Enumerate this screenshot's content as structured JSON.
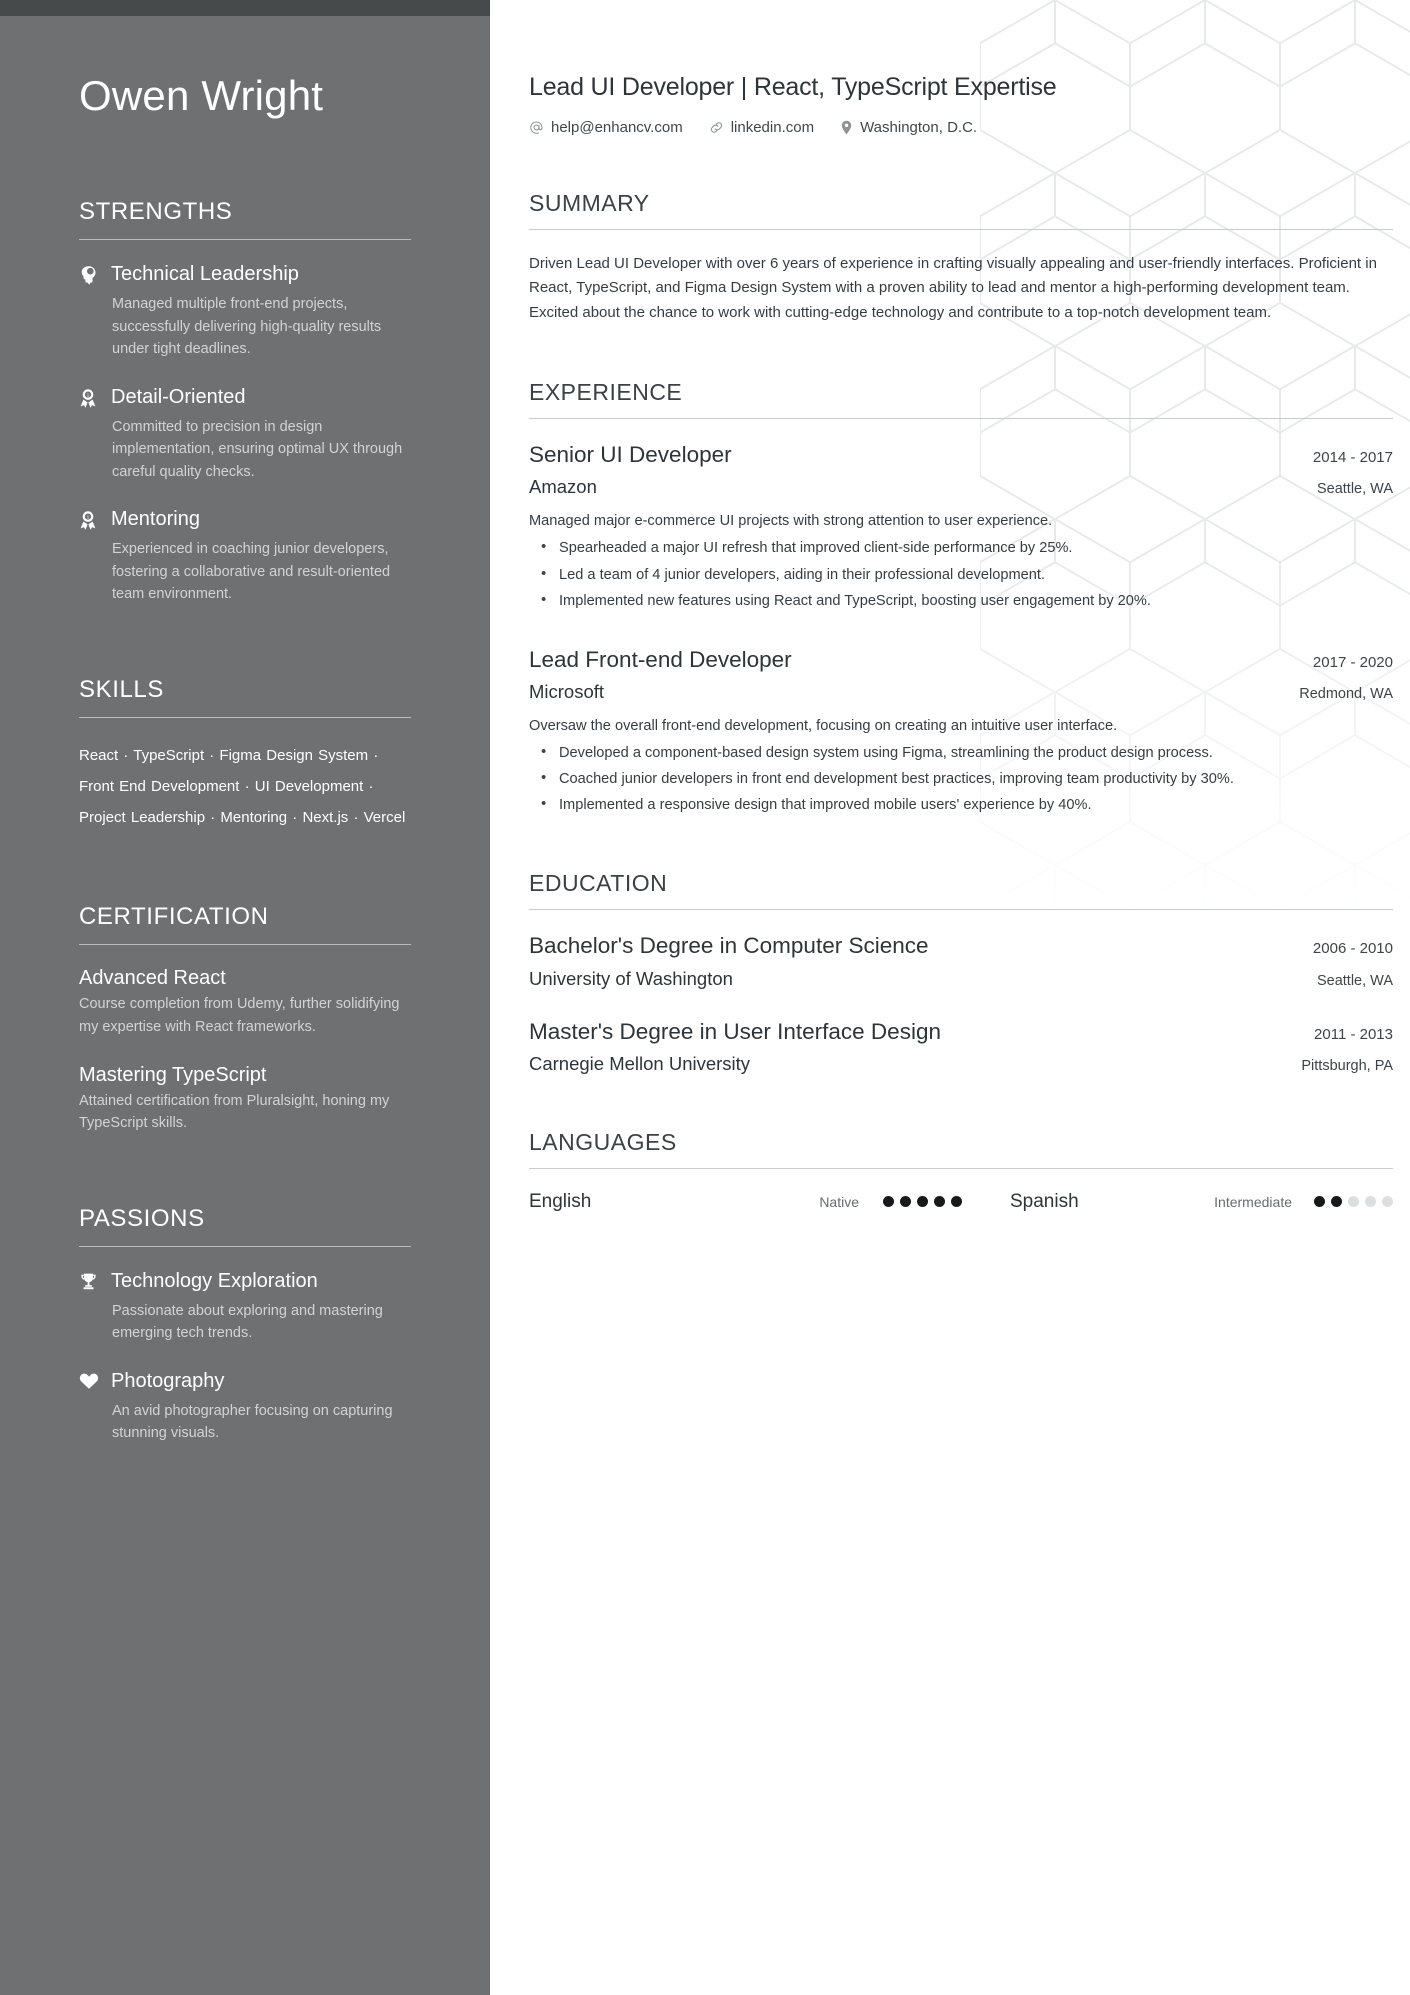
{
  "sidebar": {
    "name": "Owen Wright",
    "sections": {
      "strengths": {
        "heading": "STRENGTHS",
        "items": [
          {
            "icon": "head-idea-icon",
            "title": "Technical Leadership",
            "desc": "Managed multiple front-end projects, successfully delivering high-quality results under tight deadlines."
          },
          {
            "icon": "award-medal-icon",
            "title": "Detail-Oriented",
            "desc": "Committed to precision in design implementation, ensuring optimal UX through careful quality checks."
          },
          {
            "icon": "award-medal-icon",
            "title": "Mentoring",
            "desc": "Experienced in coaching junior developers, fostering a collaborative and result-oriented team environment."
          }
        ]
      },
      "skills": {
        "heading": "SKILLS",
        "text": "React · TypeScript · Figma Design System · Front End Development · UI Development · Project Leadership · Mentoring · Next.js · Vercel",
        "list": [
          "React",
          "TypeScript",
          "Figma Design System",
          "Front End Development",
          "UI Development",
          "Project Leadership",
          "Mentoring",
          "Next.js",
          "Vercel"
        ]
      },
      "certification": {
        "heading": "CERTIFICATION",
        "items": [
          {
            "title": "Advanced React",
            "desc": "Course completion from Udemy, further solidifying my expertise with React frameworks."
          },
          {
            "title": "Mastering TypeScript",
            "desc": "Attained certification from Pluralsight, honing my TypeScript skills."
          }
        ]
      },
      "passions": {
        "heading": "PASSIONS",
        "items": [
          {
            "icon": "trophy-icon",
            "title": "Technology Exploration",
            "desc": "Passionate about exploring and mastering emerging tech trends."
          },
          {
            "icon": "heart-icon",
            "title": "Photography",
            "desc": "An avid photographer focusing on capturing stunning visuals."
          }
        ]
      }
    }
  },
  "main": {
    "headline": "Lead UI Developer | React, TypeScript Expertise",
    "contacts": [
      {
        "icon": "at-icon",
        "text": "help@enhancv.com"
      },
      {
        "icon": "link-icon",
        "text": "linkedin.com"
      },
      {
        "icon": "location-pin-icon",
        "text": "Washington, D.C."
      }
    ],
    "summary": {
      "heading": "SUMMARY",
      "text": "Driven Lead UI Developer with over 6 years of experience in crafting visually appealing and user-friendly interfaces. Proficient in React, TypeScript, and Figma Design System with a proven ability to lead and mentor a high-performing development team. Excited about the chance to work with cutting-edge technology and contribute to a top-notch development team."
    },
    "experience": {
      "heading": "EXPERIENCE",
      "items": [
        {
          "role": "Senior UI Developer",
          "date": "2014 - 2017",
          "company": "Amazon",
          "location": "Seattle, WA",
          "summary": "Managed major e-commerce UI projects with strong attention to user experience.",
          "bullets": [
            "Spearheaded a major UI refresh that improved client-side performance by 25%.",
            "Led a team of 4 junior developers, aiding in their professional development.",
            "Implemented new features using React and TypeScript, boosting user engagement by 20%."
          ]
        },
        {
          "role": "Lead Front-end Developer",
          "date": "2017 - 2020",
          "company": "Microsoft",
          "location": "Redmond, WA",
          "summary": "Oversaw the overall front-end development, focusing on creating an intuitive user interface.",
          "bullets": [
            "Developed a component-based design system using Figma, streamlining the product design process.",
            "Coached junior developers in front end development best practices, improving team productivity by 30%.",
            "Implemented a responsive design that improved mobile users' experience by 40%."
          ]
        }
      ]
    },
    "education": {
      "heading": "EDUCATION",
      "items": [
        {
          "degree": "Bachelor's Degree in Computer Science",
          "date": "2006 - 2010",
          "school": "University of Washington",
          "location": "Seattle, WA"
        },
        {
          "degree": "Master's Degree in User Interface Design",
          "date": "2011 - 2013",
          "school": "Carnegie Mellon University",
          "location": "Pittsburgh, PA"
        }
      ]
    },
    "languages": {
      "heading": "LANGUAGES",
      "items": [
        {
          "name": "English",
          "level": "Native",
          "filled": 5,
          "total": 5
        },
        {
          "name": "Spanish",
          "level": "Intermediate",
          "filled": 2,
          "total": 5
        }
      ]
    }
  },
  "colors": {
    "sidebar_bg": "#6e7071",
    "sidebar_topbar": "#474a4b",
    "main_text": "#363d40",
    "heading_text": "#3b4245",
    "dot_filled": "#17191a",
    "dot_empty": "#dcdfe0"
  }
}
